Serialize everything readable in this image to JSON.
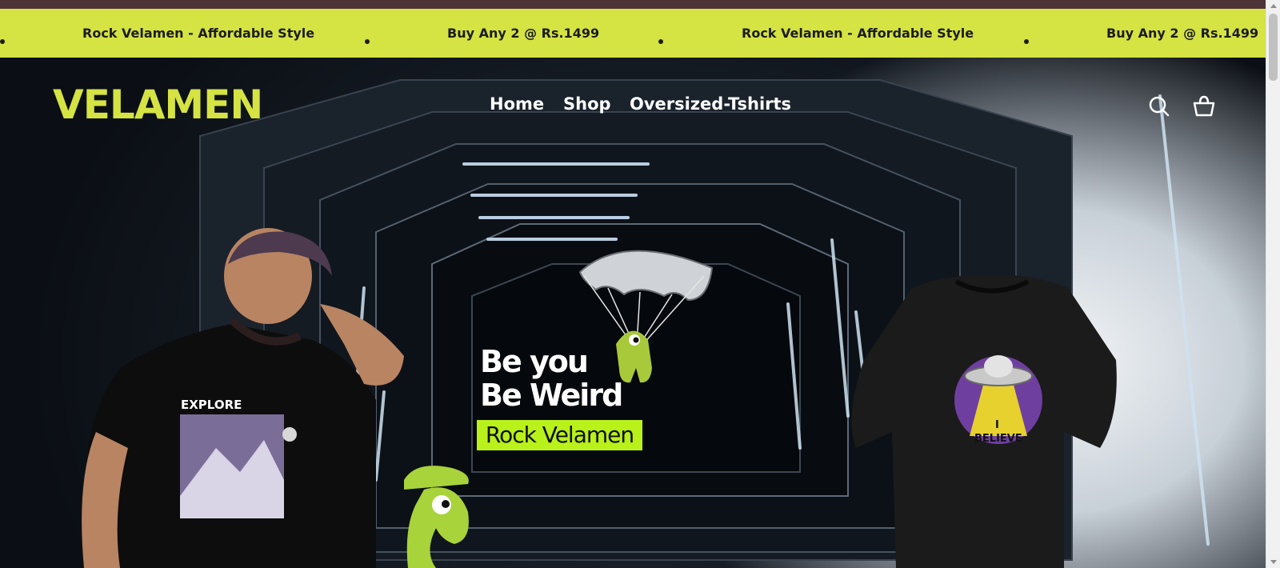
{
  "announcement": {
    "items": [
      "Rock Velamen - Affordable Style",
      "Buy Any 2 @ Rs.1499",
      "Rock Velamen - Affordable Style",
      "Buy Any 2 @ Rs.1499"
    ]
  },
  "header": {
    "logo_text": "VELAMEN",
    "nav": [
      "Home",
      "Shop",
      "Oversized-Tshirts"
    ],
    "icons": [
      "search-icon",
      "cart-icon"
    ]
  },
  "hero": {
    "line1": "Be you",
    "line2": "Be Weird",
    "badge": "Rock Velamen",
    "model_shirt_text": "EXPLORE",
    "product_shirt_text_1": "I",
    "product_shirt_text_2": "BELIEVE"
  },
  "colors": {
    "accent": "#d5e343",
    "badge": "#b9f11a",
    "topbar": "#4e3338"
  }
}
